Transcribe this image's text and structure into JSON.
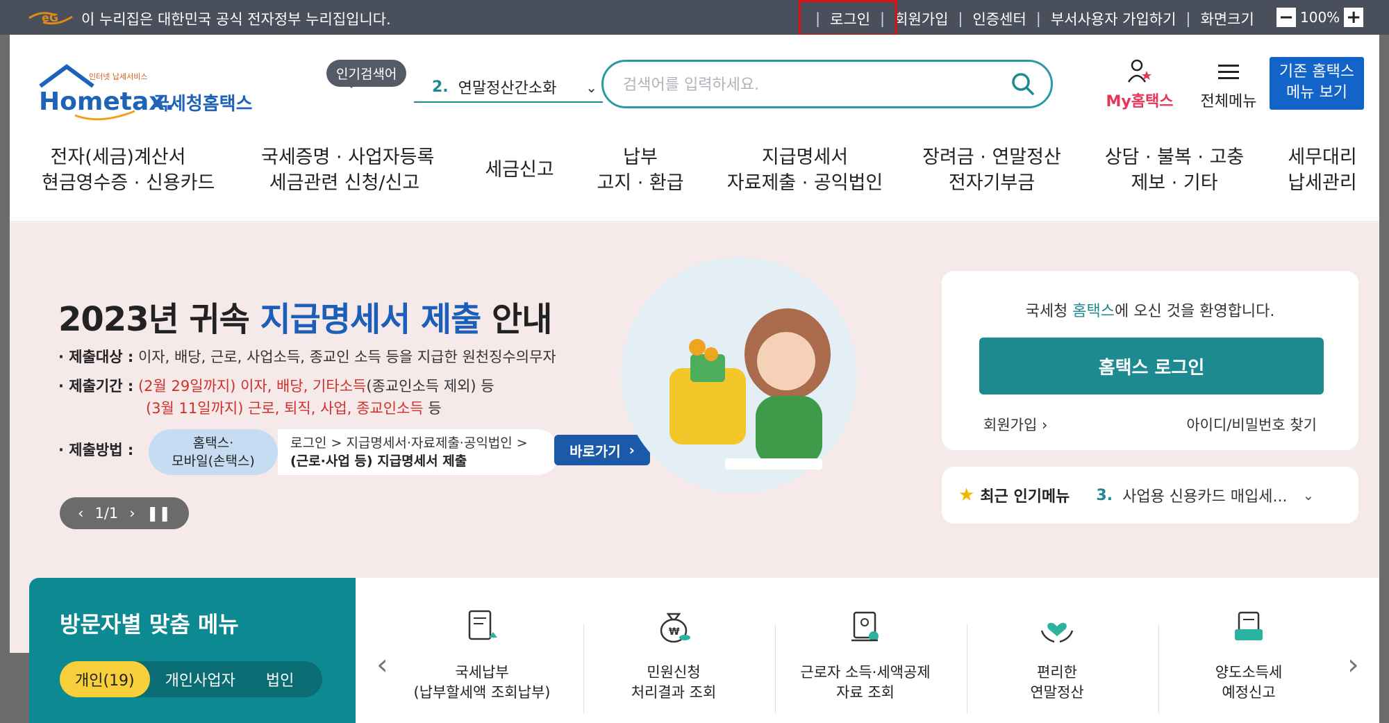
{
  "gov_bar": {
    "notice": "이 누리집은 대한민국 공식 전자정부 누리집입니다.",
    "links": [
      "로그인",
      "회원가입",
      "인증센터",
      "부서사용자 가입하기",
      "화면크기"
    ],
    "zoom_minus": "−",
    "zoom_value": "100%",
    "zoom_plus": "+"
  },
  "header": {
    "logo_small": "인터넷 납세서비스",
    "logo_main": "Hometax.",
    "logo_kor": "국세청홈택스",
    "hot_badge": "인기검색어",
    "hot_num": "2.",
    "hot_term": "연말정산간소화",
    "search_placeholder": "검색어를 입력하세요.",
    "my_hometax": "My홈택스",
    "all_menu": "전체메뉴",
    "old_menu_1": "기존 홈택스",
    "old_menu_2": "메뉴 보기"
  },
  "gnb": [
    {
      "l1": "전자(세금)계산서",
      "l2": "현금영수증 · 신용카드"
    },
    {
      "l1": "국세증명 · 사업자등록",
      "l2": "세금관련 신청/신고"
    },
    {
      "l1": "세금신고",
      "l2": ""
    },
    {
      "l1": "납부",
      "l2": "고지 · 환급"
    },
    {
      "l1": "지급명세서",
      "l2": "자료제출 · 공익법인"
    },
    {
      "l1": "장려금 · 연말정산",
      "l2": "전자기부금"
    },
    {
      "l1": "상담 · 불복 · 고충",
      "l2": "제보 · 기타"
    },
    {
      "l1": "세무대리",
      "l2": "납세관리"
    }
  ],
  "banner": {
    "title_a": "2023년 귀속 ",
    "title_hl": "지급명세서 제출",
    "title_b": " 안내",
    "target_label": "· 제출대상 :",
    "target_text": "이자, 배당, 근로, 사업소득, 종교인 소득 등을 지급한 원천징수의무자",
    "period_label": "· 제출기간 :",
    "period1_red": "(2월 29일까지) 이자, 배당, 기타소득",
    "period1_rest": "(종교인소득 제외) 등",
    "period2_red": "(3월 11일까지) 근로, 퇴직, 사업, 종교인소득",
    "period2_rest": " 등",
    "method_label": "· 제출방법 :",
    "pill_line1": "홈택스·",
    "pill_line2": "모바일(손택스)",
    "path_line1": "로그인 > 지급명세서·자료제출·공익법인 >",
    "path_line2": "(근로·사업 등) 지급명세서 제출",
    "go_button": "바로가기",
    "pager": "1/1"
  },
  "welcome": {
    "msg_a": "국세청 ",
    "msg_hl": "홈택스",
    "msg_b": "에 오신 것을 환영합니다.",
    "login_button": "홈택스 로그인",
    "join": "회원가입",
    "find": "아이디/비밀번호 찾기"
  },
  "popular": {
    "title": "최근 인기메뉴",
    "num": "3.",
    "text": "사업용 신용카드 매입세..."
  },
  "visitor": {
    "title": "방문자별 맞춤 메뉴",
    "tabs": [
      "개인(19)",
      "개인사업자",
      "법인"
    ]
  },
  "quick": [
    {
      "l1": "국세납부",
      "l2": "(납부할세액 조회납부)"
    },
    {
      "l1": "민원신청",
      "l2": "처리결과 조회"
    },
    {
      "l1": "근로자 소득·세액공제",
      "l2": "자료 조회"
    },
    {
      "l1": "편리한",
      "l2": "연말정산"
    },
    {
      "l1": "양도소득세",
      "l2": "예정신고"
    }
  ],
  "colors": {
    "teal": "#1c8a90",
    "blue": "#1364c8",
    "red_highlight": "#e01010",
    "banner_bg": "#f6e9ea"
  }
}
